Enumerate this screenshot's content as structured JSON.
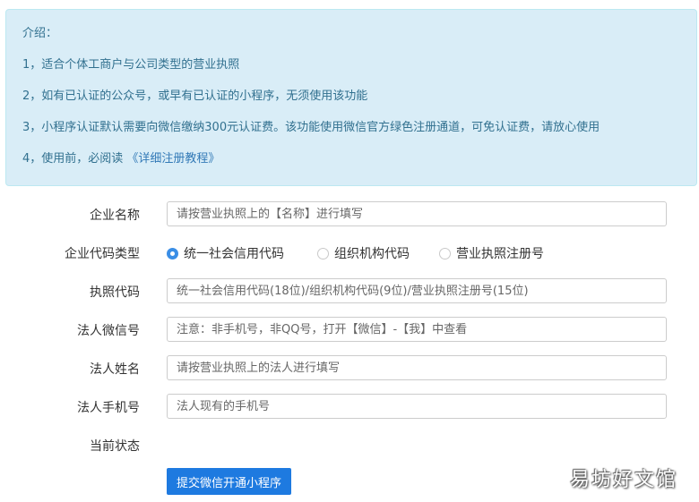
{
  "intro": {
    "title": "介绍：",
    "lines": [
      "1，适合个体工商户与公司类型的营业执照",
      "2，如有已认证的公众号，或早有已认证的小程序，无须使用该功能",
      "3，小程序认证默认需要向微信缴纳300元认证费。该功能使用微信官方绿色注册通道，可免认证费，请放心使用"
    ],
    "line4_prefix": "4，使用前，必阅读",
    "line4_link": "《详细注册教程》"
  },
  "form": {
    "company_name": {
      "label": "企业名称",
      "placeholder": "请按营业执照上的【名称】进行填写",
      "value": ""
    },
    "code_type": {
      "label": "企业代码类型",
      "options": [
        "统一社会信用代码",
        "组织机构代码",
        "营业执照注册号"
      ],
      "selected": "统一社会信用代码"
    },
    "license_code": {
      "label": "执照代码",
      "placeholder": "统一社会信用代码(18位)/组织机构代码(9位)/营业执照注册号(15位)",
      "value": ""
    },
    "legal_wechat": {
      "label": "法人微信号",
      "placeholder": "注意：非手机号，非QQ号，打开【微信】-【我】中查看",
      "value": ""
    },
    "legal_name": {
      "label": "法人姓名",
      "placeholder": "请按营业执照上的法人进行填写",
      "value": ""
    },
    "legal_phone": {
      "label": "法人手机号",
      "placeholder": "法人现有的手机号",
      "value": ""
    },
    "status": {
      "label": "当前状态",
      "value": ""
    },
    "submit_label": "提交微信开通小程序"
  },
  "watermark": "易坊好文馆",
  "colors": {
    "info_bg": "#d9edf7",
    "info_text": "#31708f",
    "link": "#337ab7",
    "button": "#1e7ae0",
    "radio_checked": "#3a8ee6"
  }
}
